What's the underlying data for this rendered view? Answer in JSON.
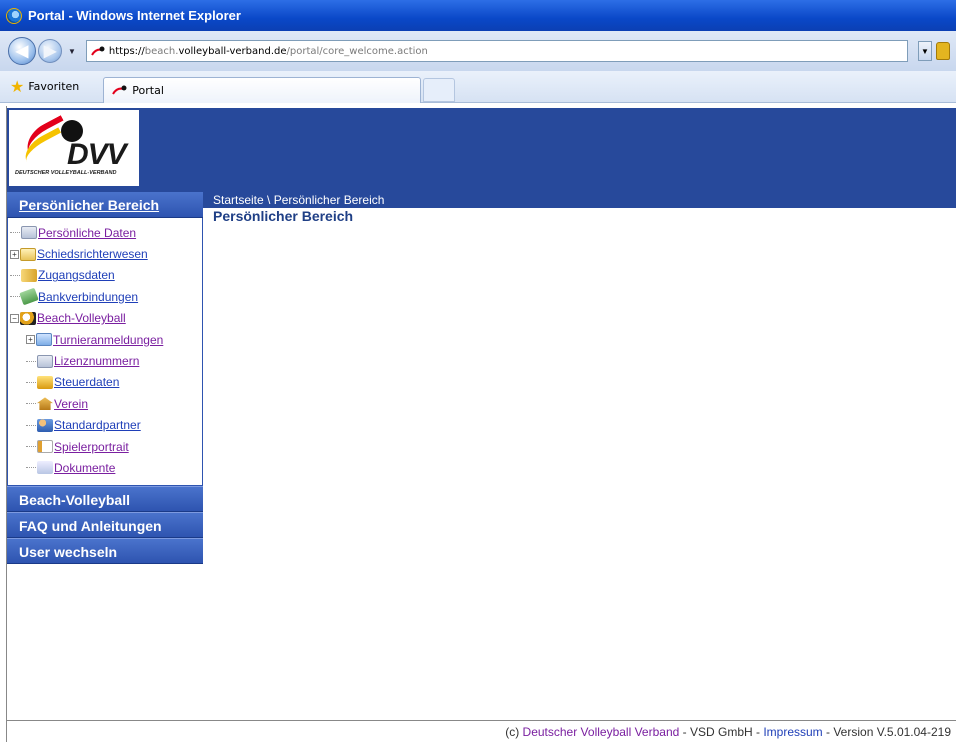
{
  "window": {
    "title": "Portal - Windows Internet Explorer"
  },
  "addressbar": {
    "url_prefix": "https://",
    "url_dim1": "beach.",
    "url_host": "volleyball-verband.de",
    "url_dim2": "/portal/core_welcome.action"
  },
  "favbar": {
    "favorites_label": "Favoriten",
    "tab_label": "Portal"
  },
  "logo": {
    "text": "DVV",
    "subtitle": "DEUTSCHER VOLLEYBALL-VERBAND"
  },
  "breadcrumb": "Startseite \\ Persönlicher Bereich",
  "content": {
    "title": "Persönlicher Bereich"
  },
  "sidebar": {
    "active_section": "Persönlicher Bereich",
    "tree": [
      {
        "label": "Persönliche Daten"
      },
      {
        "label": "Schiedsrichterwesen"
      },
      {
        "label": "Zugangsdaten"
      },
      {
        "label": "Bankverbindungen"
      },
      {
        "label": "Beach-Volleyball"
      },
      {
        "label": "Turnieranmeldungen"
      },
      {
        "label": "Lizenznummern"
      },
      {
        "label": "Steuerdaten"
      },
      {
        "label": "Verein"
      },
      {
        "label": "Standardpartner"
      },
      {
        "label": "Spielerportrait"
      },
      {
        "label": "Dokumente"
      }
    ],
    "sections": [
      {
        "label": "Beach-Volleyball"
      },
      {
        "label": "FAQ und Anleitungen"
      },
      {
        "label": "User wechseln"
      }
    ]
  },
  "footer": {
    "copyright": "(c) ",
    "org_link": "Deutscher Volleyball Verband",
    "sep1": " - VSD GmbH - ",
    "impressum_link": "Impressum",
    "version": " - Version V.5.01.04-219"
  }
}
